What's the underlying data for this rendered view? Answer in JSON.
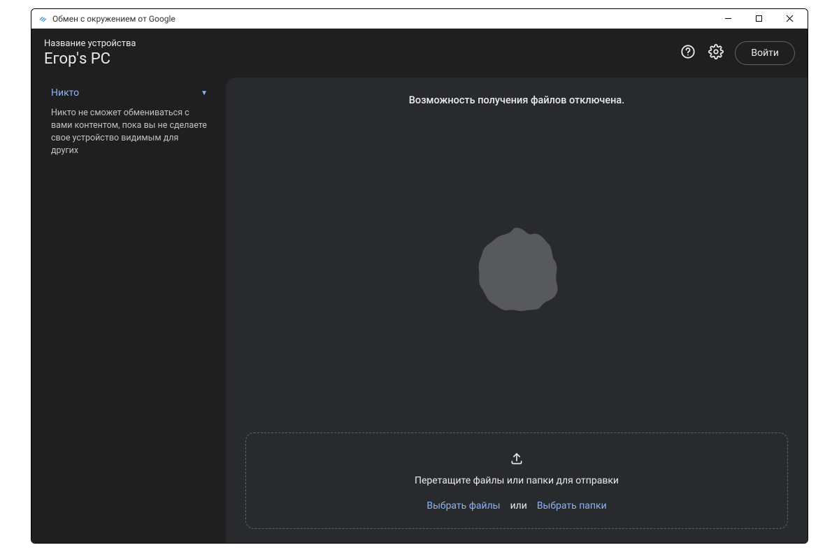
{
  "window": {
    "title": "Обмен с окружением от Google"
  },
  "header": {
    "device_label": "Название устройства",
    "device_name": "Егор's PC",
    "login_label": "Войти"
  },
  "sidebar": {
    "visibility_value": "Никто",
    "visibility_desc": "Никто не сможет обмениваться с вами контентом, пока вы не сделаете свое устройство видимым для других"
  },
  "main": {
    "receive_status": "Возможность получения файлов отключена.",
    "drop_text": "Перетащите файлы или папки для отправки",
    "select_files_label": "Выбрать файлы",
    "or_label": "или",
    "select_folders_label": "Выбрать папки"
  },
  "icons": {
    "help": "help-icon",
    "settings": "gear-icon",
    "upload": "upload-icon",
    "caret": "caret-down-icon",
    "app": "nearby-share-icon"
  }
}
